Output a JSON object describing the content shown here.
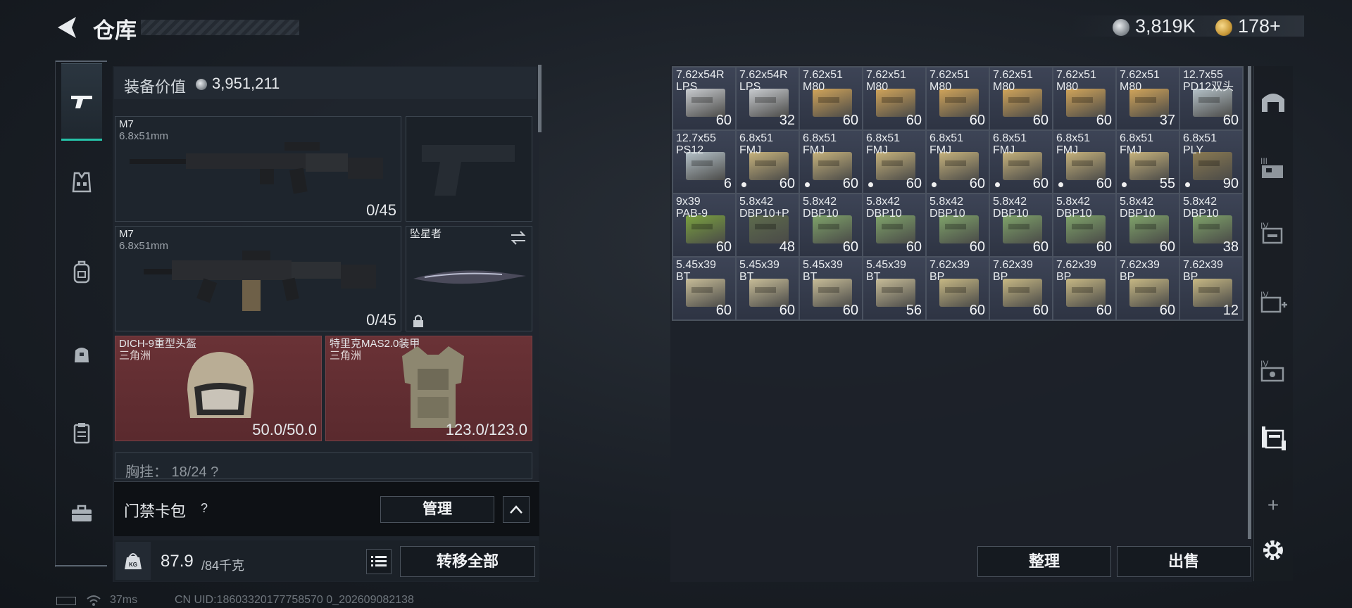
{
  "header": {
    "title": "仓库"
  },
  "currency": [
    {
      "name": "coin-silver",
      "value": "3,819K",
      "color": "#b9bec4"
    },
    {
      "name": "coin-gold",
      "value": "178+",
      "color": "#d4a54a"
    }
  ],
  "left_tabs": [
    {
      "icon": "gun-icon",
      "active": true
    },
    {
      "icon": "vest-icon"
    },
    {
      "icon": "backpack-icon"
    },
    {
      "icon": "bag-icon"
    },
    {
      "icon": "clipboard-icon"
    },
    {
      "icon": "toolbox-icon"
    }
  ],
  "equip_value": {
    "label": "装备价值",
    "value": "3,951,211"
  },
  "slots": {
    "primary1": {
      "name": "M7",
      "caliber": "6.8x51mm",
      "ammo": "0/45"
    },
    "secondary": {
      "name": "",
      "ammo": ""
    },
    "primary2": {
      "name": "M7",
      "caliber": "6.8x51mm",
      "ammo": "0/45"
    },
    "melee": {
      "name": "坠星者"
    },
    "helmet": {
      "name": "DICH-9重型头盔",
      "sub": "三角洲",
      "durability": "50.0/50.0"
    },
    "armor": {
      "name": "特里克MAS2.0装甲",
      "sub": "三角洲",
      "durability": "123.0/123.0"
    },
    "chest_partial": "胸挂：  18/24   ?"
  },
  "keycard": {
    "label": "门禁卡包",
    "help": "?",
    "manage": "管理"
  },
  "weight": {
    "current": "87.9",
    "max": "/84千克",
    "transfer": "转移全部"
  },
  "status": {
    "ping": "37ms",
    "uid": "CN UID:18603320177758570 0_202609082138"
  },
  "storage": {
    "items": [
      {
        "l1": "7.62x54R",
        "l2": "LPS",
        "qty": "60",
        "color": "#c9ccd0"
      },
      {
        "l1": "7.62x54R",
        "l2": "LPS",
        "qty": "32",
        "color": "#c9ccd0"
      },
      {
        "l1": "7.62x51",
        "l2": "M80",
        "qty": "60",
        "color": "#d2a55a"
      },
      {
        "l1": "7.62x51",
        "l2": "M80",
        "qty": "60",
        "color": "#d2a55a"
      },
      {
        "l1": "7.62x51",
        "l2": "M80",
        "qty": "60",
        "color": "#d2a55a"
      },
      {
        "l1": "7.62x51",
        "l2": "M80",
        "qty": "60",
        "color": "#d2a55a"
      },
      {
        "l1": "7.62x51",
        "l2": "M80",
        "qty": "60",
        "color": "#d2a55a"
      },
      {
        "l1": "7.62x51",
        "l2": "M80",
        "qty": "37",
        "color": "#d2a55a"
      },
      {
        "l1": "12.7x55",
        "l2": "PD12双头",
        "qty": "60",
        "color": "#b5c2c9"
      },
      {
        "l1": "12.7x55",
        "l2": "PS12",
        "qty": "6",
        "color": "#b5c2c9"
      },
      {
        "l1": "6.8x51",
        "l2": "FMJ",
        "qty": "60",
        "color": "#c6b27c",
        "dot": true
      },
      {
        "l1": "6.8x51",
        "l2": "FMJ",
        "qty": "60",
        "color": "#c6b27c",
        "dot": true
      },
      {
        "l1": "6.8x51",
        "l2": "FMJ",
        "qty": "60",
        "color": "#c6b27c",
        "dot": true
      },
      {
        "l1": "6.8x51",
        "l2": "FMJ",
        "qty": "60",
        "color": "#c6b27c",
        "dot": true
      },
      {
        "l1": "6.8x51",
        "l2": "FMJ",
        "qty": "60",
        "color": "#c6b27c",
        "dot": true
      },
      {
        "l1": "6.8x51",
        "l2": "FMJ",
        "qty": "60",
        "color": "#c6b27c",
        "dot": true
      },
      {
        "l1": "6.8x51",
        "l2": "FMJ",
        "qty": "55",
        "color": "#c6b27c",
        "dot": true
      },
      {
        "l1": "6.8x51",
        "l2": "PLY",
        "qty": "90",
        "color": "#8a7a52",
        "dot": true
      },
      {
        "l1": "9x39",
        "l2": "PAB-9",
        "qty": "60",
        "color": "#7aa13f"
      },
      {
        "l1": "5.8x42",
        "l2": "DBP10+P",
        "qty": "48",
        "color": "#5d6b4c"
      },
      {
        "l1": "5.8x42",
        "l2": "DBP10",
        "qty": "60",
        "color": "#7fa36a"
      },
      {
        "l1": "5.8x42",
        "l2": "DBP10",
        "qty": "60",
        "color": "#7fa36a"
      },
      {
        "l1": "5.8x42",
        "l2": "DBP10",
        "qty": "60",
        "color": "#7fa36a"
      },
      {
        "l1": "5.8x42",
        "l2": "DBP10",
        "qty": "60",
        "color": "#7fa36a"
      },
      {
        "l1": "5.8x42",
        "l2": "DBP10",
        "qty": "60",
        "color": "#7fa36a"
      },
      {
        "l1": "5.8x42",
        "l2": "DBP10",
        "qty": "60",
        "color": "#7fa36a"
      },
      {
        "l1": "5.8x42",
        "l2": "DBP10",
        "qty": "38",
        "color": "#7fa36a"
      },
      {
        "l1": "5.45x39",
        "l2": "BT",
        "qty": "60",
        "color": "#c8bd98"
      },
      {
        "l1": "5.45x39",
        "l2": "BT",
        "qty": "60",
        "color": "#c8bd98"
      },
      {
        "l1": "5.45x39",
        "l2": "BT",
        "qty": "60",
        "color": "#c8bd98"
      },
      {
        "l1": "5.45x39",
        "l2": "BT",
        "qty": "56",
        "color": "#c8bd98"
      },
      {
        "l1": "7.62x39",
        "l2": "BP",
        "qty": "60",
        "color": "#c7b884"
      },
      {
        "l1": "7.62x39",
        "l2": "BP",
        "qty": "60",
        "color": "#c7b884"
      },
      {
        "l1": "7.62x39",
        "l2": "BP",
        "qty": "60",
        "color": "#c7b884"
      },
      {
        "l1": "7.62x39",
        "l2": "BP",
        "qty": "60",
        "color": "#c7b884"
      },
      {
        "l1": "7.62x39",
        "l2": "BP",
        "qty": "12",
        "color": "#c7b884"
      }
    ],
    "sort": "整理",
    "sell": "出售"
  },
  "right_tabs": [
    {
      "icon": "storage-home-icon"
    },
    {
      "icon": "storage-3-icon"
    },
    {
      "icon": "storage-4-icon"
    },
    {
      "icon": "storage-med-icon"
    },
    {
      "icon": "storage-tools-icon"
    },
    {
      "icon": "storage-cases-icon",
      "active": true
    },
    {
      "icon": "add-icon",
      "label": "+"
    },
    {
      "icon": "settings-icon"
    }
  ]
}
